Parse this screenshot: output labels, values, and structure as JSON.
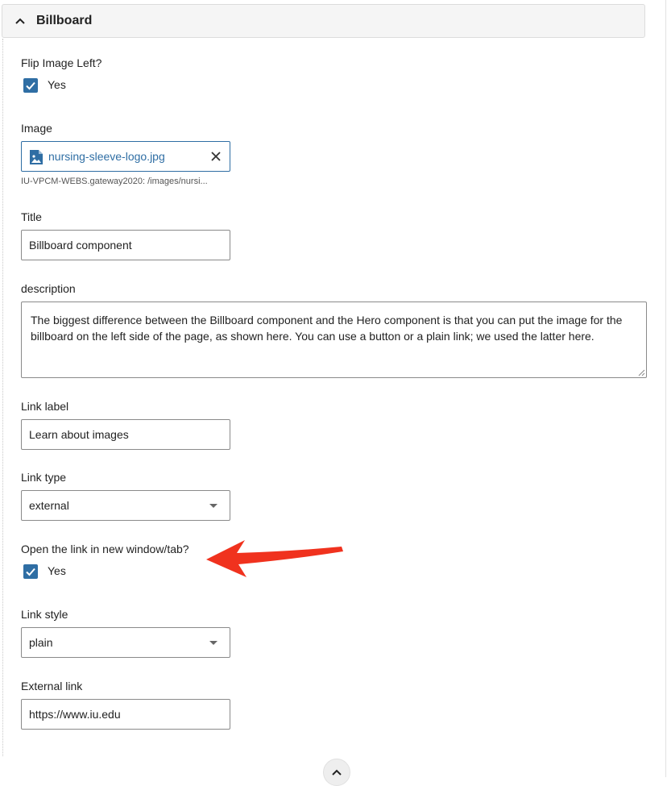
{
  "panel": {
    "title": "Billboard"
  },
  "flip_image": {
    "label": "Flip Image Left?",
    "checked": true,
    "option": "Yes"
  },
  "image": {
    "label": "Image",
    "filename": "nursing-sleeve-logo.jpg",
    "path": "IU-VPCM-WEBS.gateway2020: /images/nursi..."
  },
  "title_field": {
    "label": "Title",
    "value": "Billboard component"
  },
  "description": {
    "label": "description",
    "value": "The biggest difference between the Billboard component and the Hero component is that you can put the image for the billboard on the left side of the page, as shown here. You can use a button or a plain link; we used the latter here."
  },
  "link_label": {
    "label": "Link label",
    "value": "Learn about images"
  },
  "link_type": {
    "label": "Link type",
    "value": "external"
  },
  "new_window": {
    "label": "Open the link in new window/tab?",
    "checked": true,
    "option": "Yes"
  },
  "link_style": {
    "label": "Link style",
    "value": "plain"
  },
  "external_link": {
    "label": "External link",
    "value": "https://www.iu.edu"
  },
  "colors": {
    "accent": "#2f6ea4",
    "annotation_arrow": "#f0321e"
  }
}
